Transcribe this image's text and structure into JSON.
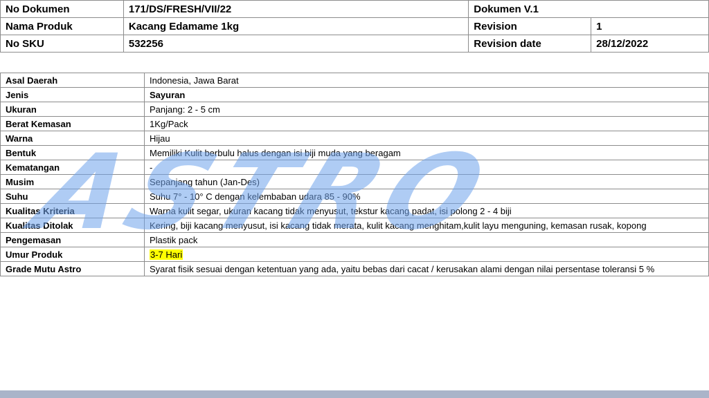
{
  "header": {
    "doc_no_label": "No Dokumen",
    "doc_no_value": "171/DS/FRESH/VII/22",
    "doc_version": "Dokumen V.1",
    "product_label": "Nama Produk",
    "product_value": "Kacang Edamame 1kg",
    "revision_label": "Revision",
    "revision_value": "1",
    "sku_label": "No SKU",
    "sku_value": "532256",
    "revision_date_label": "Revision date",
    "revision_date_value": "28/12/2022"
  },
  "spec_rows": [
    {
      "label": "Asal Daerah",
      "value": "Indonesia, Jawa Barat"
    },
    {
      "label": "Jenis",
      "value": "Sayuran"
    },
    {
      "label": "Ukuran",
      "value": "Panjang: 2 - 5 cm"
    },
    {
      "label": "Berat Kemasan",
      "value": "1Kg/Pack"
    },
    {
      "label": "Warna",
      "value": "Hijau"
    },
    {
      "label": "Bentuk",
      "value": "Memiliki Kulit berbulu halus dengan isi biji muda yang beragam"
    },
    {
      "label": "Kematangan",
      "value": "-"
    },
    {
      "label": "Musim",
      "value": "Sepanjang tahun (Jan-Des)"
    },
    {
      "label": "Suhu",
      "value": "Suhu 7° - 10° C dengan kelembaban udara 85 - 90%"
    },
    {
      "label": "Kualitas Kriteria",
      "value": "Warna kulit segar, ukuran kacang tidak menyusut, tekstur kacang padat, isi polong 2 - 4 biji"
    },
    {
      "label": "Kualitas Ditolak",
      "value": "Kering, biji kacang menyusut, isi kacang tidak merata, kulit kacang menghitam,kulit layu menguning, kemasan rusak, kopong"
    },
    {
      "label": "Pengemasan",
      "value": "Plastik pack"
    },
    {
      "label": "Umur Produk",
      "value": "3-7 Hari"
    },
    {
      "label": "Grade Mutu Astro",
      "value": "Syarat fisik sesuai dengan ketentuan yang ada, yaitu bebas dari cacat / kerusakan alami dengan  nilai persentase toleransi 5 %"
    }
  ],
  "watermark": {
    "text": "ASTRO",
    "color": "#6fa3ec"
  },
  "colors": {
    "highlight": "#ffff00",
    "border": "#8c8c8c",
    "bottom_bar": "#aab4c9"
  }
}
